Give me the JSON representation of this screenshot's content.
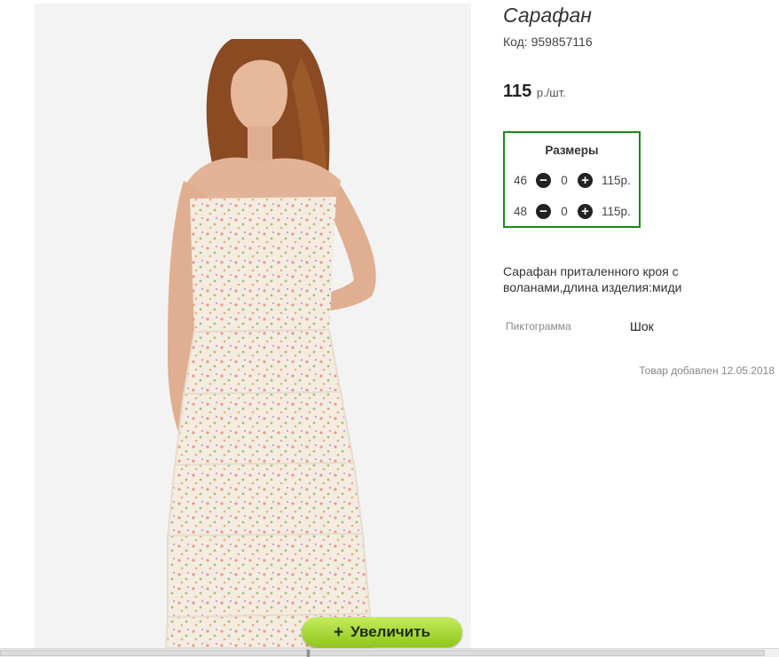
{
  "product": {
    "title": "Сарафан",
    "code": "Код: 959857116",
    "price": "115",
    "price_unit": "р./шт."
  },
  "sizes": {
    "title": "Размеры",
    "rows": [
      {
        "size": "46",
        "qty": "0",
        "price": "115р."
      },
      {
        "size": "48",
        "qty": "0",
        "price": "115р."
      }
    ]
  },
  "description": "Сарафан приталенного кроя с воланами,длина изделия:миди",
  "attribute": {
    "name": "Пиктограмма",
    "value": "Шок"
  },
  "added": "Товар добавлен 12.05.2018",
  "zoom_button": {
    "label": "Увеличить",
    "icon": "plus-icon"
  },
  "colors": {
    "size_box_border": "#1a8a1a",
    "zoom_button": "#a4d73a"
  }
}
